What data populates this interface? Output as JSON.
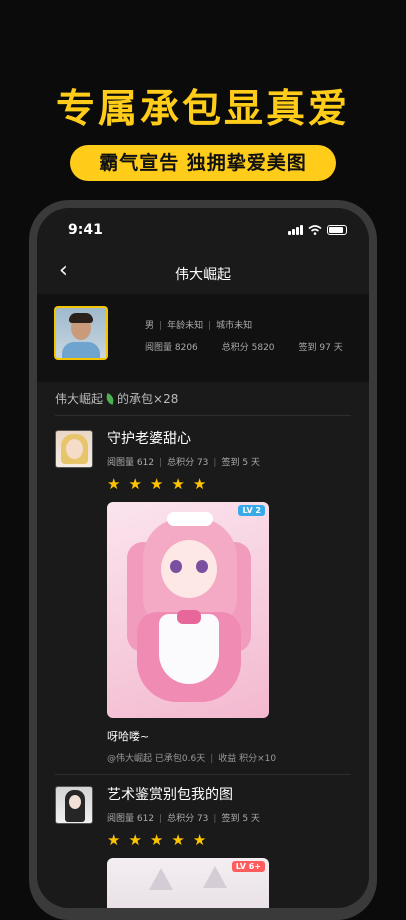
{
  "promo": {
    "headline": "专属承包显真爱",
    "subheadline": "霸气宣告 独拥挚爱美图"
  },
  "statusbar": {
    "time": "9:41"
  },
  "nav": {
    "title": "伟大崛起"
  },
  "profile": {
    "gender": "男",
    "age": "年龄未知",
    "city": "城市未知",
    "views": "阅图量 8206",
    "points": "总积分 5820",
    "checkin": "签到 97 天"
  },
  "section": {
    "user": "伟大崛起",
    "suffix": "的承包×28"
  },
  "posts": [
    {
      "title": "守护老婆甜心",
      "views": "阅图量 612",
      "points": "总积分 73",
      "checkin": "签到 5 天",
      "rating": 5,
      "level": "LV 2",
      "caption": "呀哈喽~",
      "meta_author": "@伟大崛起",
      "meta_duration": "已承包0.6天",
      "meta_income": "收益 积分×10"
    },
    {
      "title": "艺术鉴赏别包我的图",
      "views": "阅图量 612",
      "points": "总积分 73",
      "checkin": "签到 5 天",
      "rating": 5,
      "level": "LV 6+"
    }
  ]
}
